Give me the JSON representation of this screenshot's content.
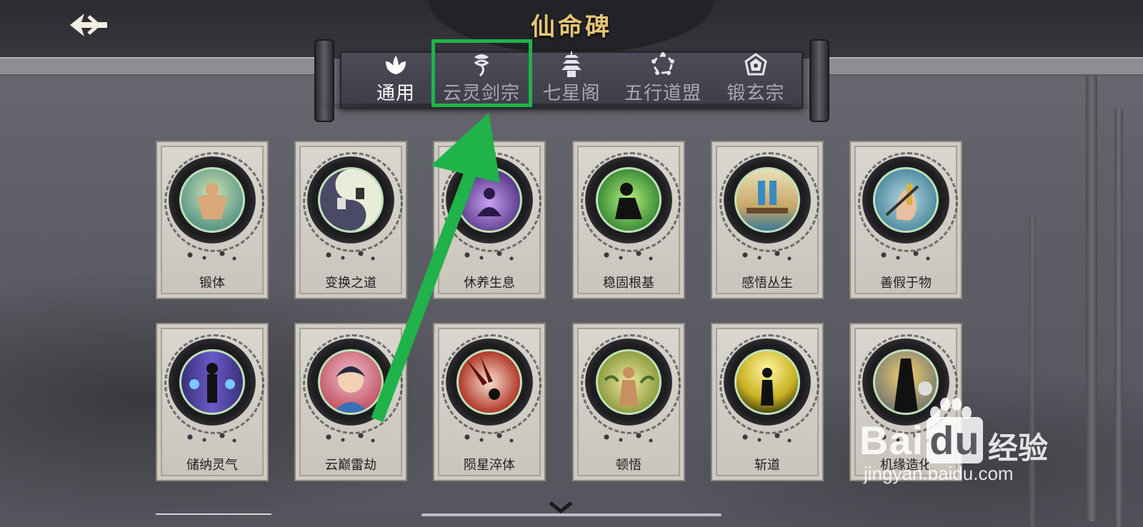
{
  "header": {
    "title": "仙命碑"
  },
  "tabs": [
    {
      "label": "通用",
      "icon": "lotus-icon",
      "active": true
    },
    {
      "label": "云灵剑宗",
      "icon": "cloud-icon",
      "active": false
    },
    {
      "label": "七星阁",
      "icon": "pagoda-icon",
      "active": false
    },
    {
      "label": "五行道盟",
      "icon": "five-elements-icon",
      "active": false
    },
    {
      "label": "锻玄宗",
      "icon": "forge-emblem-icon",
      "active": false
    }
  ],
  "cards": [
    {
      "name": "锻体",
      "color": "#5f9a8a"
    },
    {
      "name": "变换之道",
      "color": "#4a4a66"
    },
    {
      "name": "休养生息",
      "color": "#5a3a8c"
    },
    {
      "name": "稳固根基",
      "color": "#3f8f3a"
    },
    {
      "name": "感悟丛生",
      "color": "#3b7a9a"
    },
    {
      "name": "善假于物",
      "color": "#4c8aa0"
    },
    {
      "name": "储纳灵气",
      "color": "#3a2f7a"
    },
    {
      "name": "云巅雷劫",
      "color": "#c45a6a"
    },
    {
      "name": "陨星淬体",
      "color": "#b23a2a"
    },
    {
      "name": "顿悟",
      "color": "#8a9a3a"
    },
    {
      "name": "斩道",
      "color": "#c8b020"
    },
    {
      "name": "机缘造化",
      "color": "#7a7a70"
    }
  ],
  "watermark": {
    "brand": "Bai",
    "brand2": "du",
    "suffix": "经验",
    "url": "jingyan.baidu.com"
  },
  "annotation": {
    "color": "#20b34a"
  }
}
